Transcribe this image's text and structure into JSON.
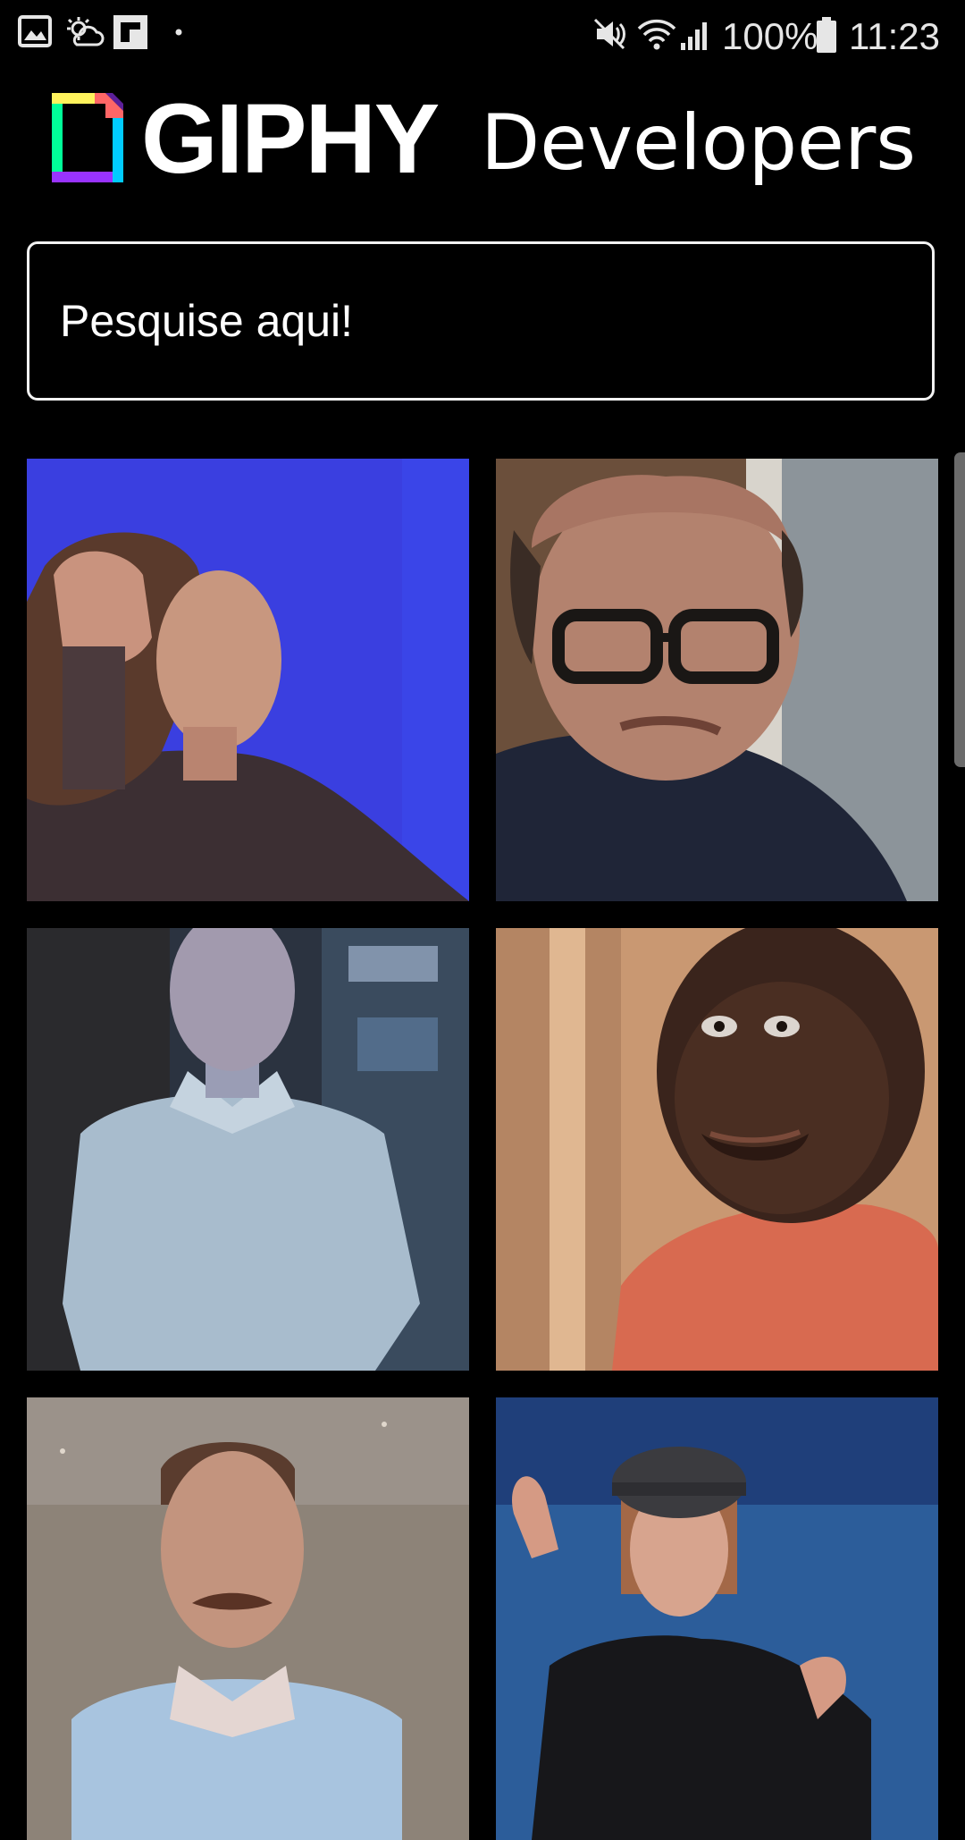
{
  "status_bar": {
    "left_icons": [
      "image-icon",
      "weather-icon",
      "flipboard-icon",
      "dot-icon"
    ],
    "right_icons": [
      "mute-icon",
      "wifi-icon",
      "signal-icon",
      "battery-icon"
    ],
    "battery": "100%",
    "time": "11:23"
  },
  "header": {
    "brand": "GIPHY",
    "subtitle": "Developers",
    "logo_colors": [
      "#00ff99",
      "#00ccff",
      "#9933ff",
      "#ff6666",
      "#fff35c"
    ]
  },
  "search": {
    "placeholder": "Pesquise aqui!",
    "value": ""
  },
  "gif_grid": {
    "items": [
      {
        "subject": "woman touching hair on blue background",
        "background": "#3a3fe0"
      },
      {
        "subject": "bald man with glasses frowning",
        "background": "#2a2a35"
      },
      {
        "subject": "man in light blue polo shirt",
        "background": "#2b3340"
      },
      {
        "subject": "smiling man with beard in orange shirt",
        "background": "#c99872"
      },
      {
        "subject": "man with mustache in blue suit",
        "background": "#8d8378"
      },
      {
        "subject": "woman in cap shrugging on blue background",
        "background": "#2c5d9a"
      }
    ]
  },
  "colors": {
    "background": "#000000",
    "text": "#ffffff",
    "search_border": "#f2f2f2"
  }
}
